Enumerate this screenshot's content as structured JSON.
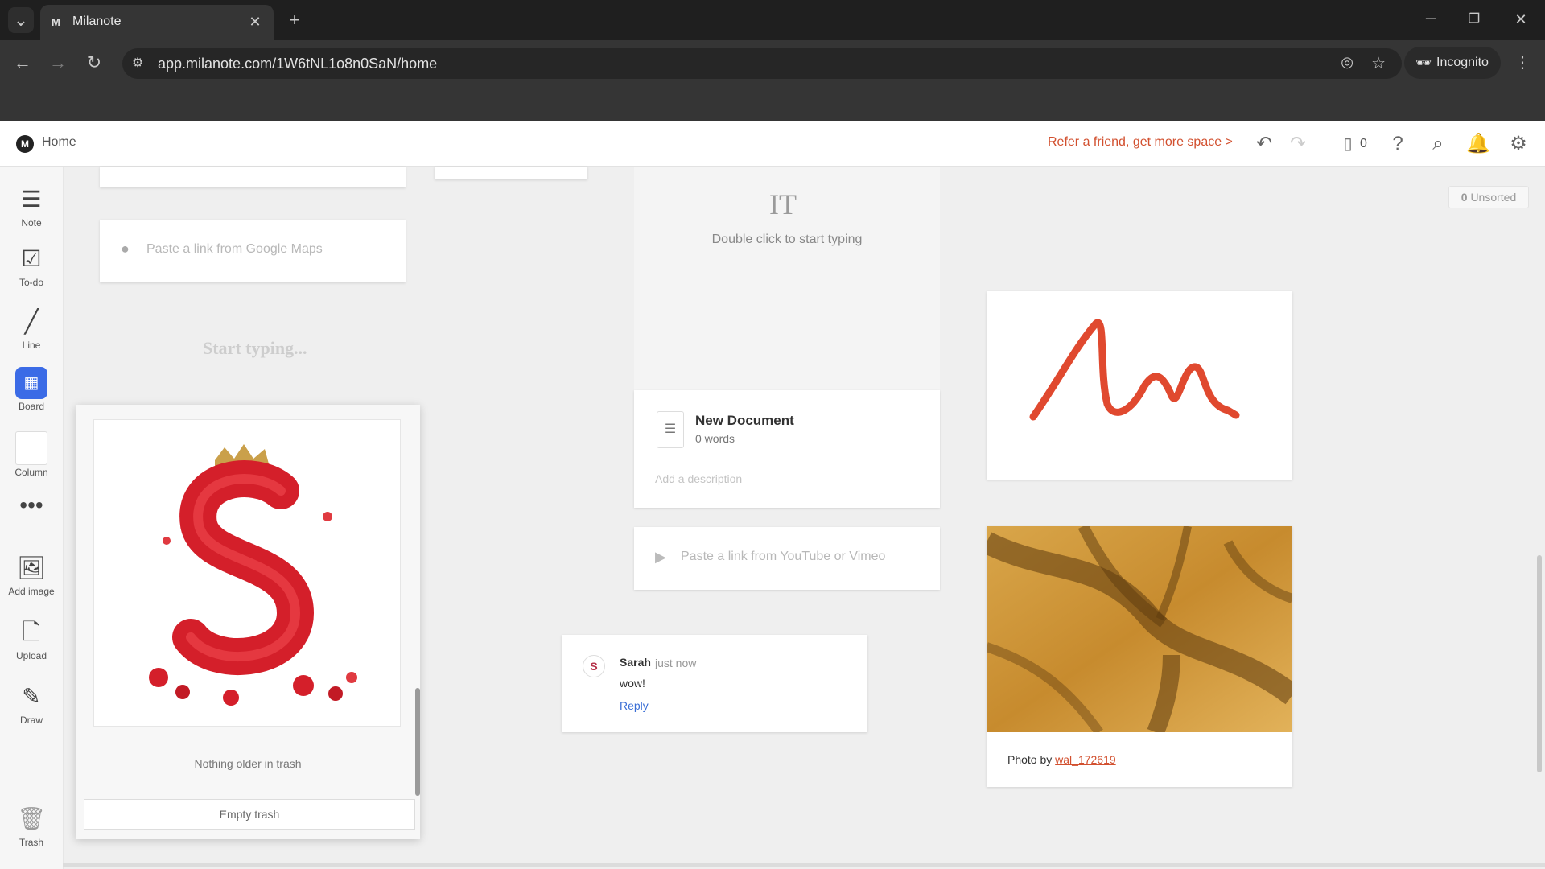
{
  "browser": {
    "tab_title": "Milanote",
    "url": "app.milanote.com/1W6tNL1o8n0SaN/home",
    "incognito_label": "Incognito"
  },
  "header": {
    "home_label": "Home",
    "refer_text": "Refer a friend, get more space >",
    "device_count": "0"
  },
  "toolbar": {
    "items": [
      {
        "label": "Note"
      },
      {
        "label": "To-do"
      },
      {
        "label": "Line"
      },
      {
        "label": "Board"
      },
      {
        "label": "Column"
      },
      {
        "label": "Add image"
      },
      {
        "label": "Upload"
      },
      {
        "label": "Draw"
      },
      {
        "label": "Trash"
      }
    ]
  },
  "canvas": {
    "maps_placeholder": "Paste a link from Google Maps",
    "start_typing": "Start typing...",
    "text_hint": "Double click to start typing",
    "document": {
      "title": "New Document",
      "words": "0 words",
      "description_placeholder": "Add a description"
    },
    "video_placeholder": "Paste a link from YouTube or Vimeo",
    "unsorted_count": "0",
    "unsorted_label": "Unsorted",
    "photo_credit_prefix": "Photo by",
    "photo_credit_author": "wal_172619"
  },
  "comment": {
    "author": "Sarah",
    "time": "just now",
    "text": "wow!",
    "reply_label": "Reply",
    "avatar_letter": "S"
  },
  "trash_panel": {
    "nothing_older": "Nothing older in trash",
    "empty_label": "Empty trash"
  },
  "colors": {
    "accent_orange": "#d2502f",
    "board_blue": "#3b6be6",
    "scribble_red": "#e0492f",
    "reply_blue": "#3b6fd6"
  }
}
